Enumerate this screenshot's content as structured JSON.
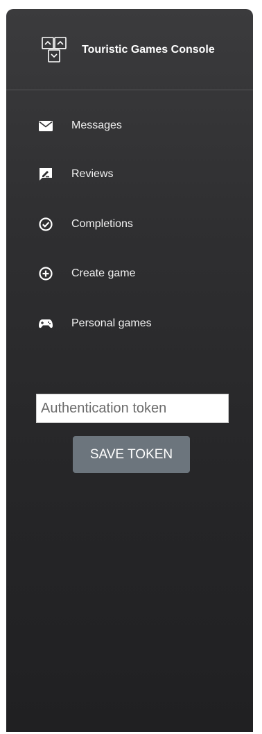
{
  "brand": {
    "title": "Touristic Games Console",
    "logo_icon": "puzzle-grid-icon"
  },
  "nav": {
    "items": [
      {
        "label": "Messages",
        "icon": "envelope-icon"
      },
      {
        "label": "Reviews",
        "icon": "review-pen-icon"
      },
      {
        "label": "Completions",
        "icon": "check-circle-icon"
      },
      {
        "label": "Create game",
        "icon": "plus-circle-icon"
      },
      {
        "label": "Personal games",
        "icon": "gamepad-icon"
      }
    ]
  },
  "token": {
    "placeholder": "Authentication token",
    "value": "",
    "save_label": "SAVE TOKEN"
  },
  "colors": {
    "sidebar_top": "#3b3b3d",
    "sidebar_bottom": "#202022",
    "button_bg": "#6c757d",
    "text": "#ffffff"
  }
}
